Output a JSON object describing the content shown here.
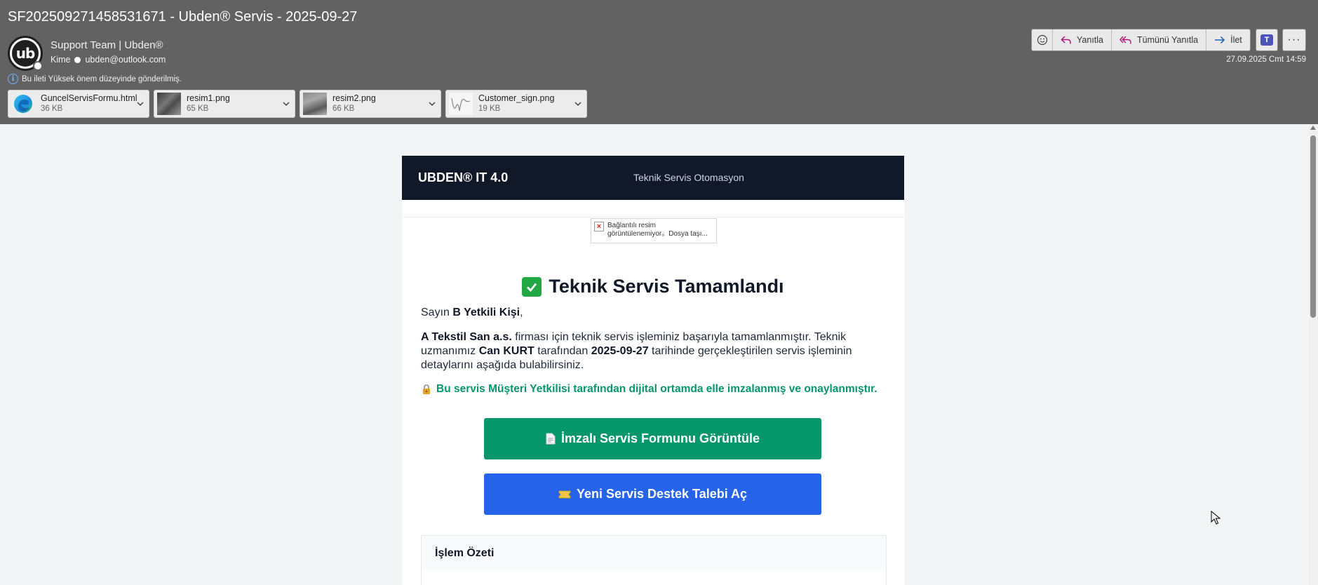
{
  "header": {
    "subject": "SF202509271458531671 - Ubden® Servis - 2025-09-27",
    "sender": "Support Team | Ubden®",
    "to_label": "Kime",
    "to_address": "ubden@outlook.com",
    "importance_note": "Bu ileti Yüksek önem düzeyinde gönderilmiş.",
    "date": "27.09.2025 Cmt 14:59",
    "avatar_text": "ub"
  },
  "toolbar": {
    "reply": "Yanıtla",
    "reply_all": "Tümünü Yanıtla",
    "forward": "İlet",
    "icons": [
      "emoji-icon",
      "reply-icon",
      "reply-all-icon",
      "forward-icon",
      "teams-icon",
      "more-icon"
    ]
  },
  "attachments": [
    {
      "name": "GuncelServisFormu.html",
      "size": "36 KB"
    },
    {
      "name": "resim1.png",
      "size": "65 KB"
    },
    {
      "name": "resim2.png",
      "size": "66 KB"
    },
    {
      "name": "Customer_sign.png",
      "size": "19 KB"
    }
  ],
  "email": {
    "brand": "UBDEN® IT 4.0",
    "tagline": "Teknik Servis Otomasyon",
    "broken_image_text": "Bağlantılı resim görüntülenemiyor。Dosya taşı...",
    "title": "Teknik Servis Tamamlandı",
    "greeting_prefix": "Sayın",
    "greeting_name": "B Yetkili Kişi",
    "greeting_suffix": ",",
    "company": "A Tekstil San a.s.",
    "body_part1": " firması için teknik servis işleminiz başarıyla tamamlanmıştır. Teknik uzmanımız ",
    "technician": "Can KURT",
    "body_part2": " tarafından ",
    "service_date": "2025-09-27",
    "body_part3": " tarihinde gerçekleştirilen servis işleminin detaylarını aşağıda bulabilirsiniz.",
    "signed_note": "Bu servis Müşteri Yetkilisi tarafından dijital ortamda elle imzalanmış ve onaylanmıştır.",
    "btn_view_form": "İmzalı Servis Formunu Görüntüle",
    "btn_new_ticket": "Yeni Servis Destek Talebi Aç",
    "summary_title": "İşlem Özeti"
  },
  "colors": {
    "header_bg": "#626262",
    "email_header_bg": "#111827",
    "green": "#059669",
    "blue": "#2563eb"
  }
}
